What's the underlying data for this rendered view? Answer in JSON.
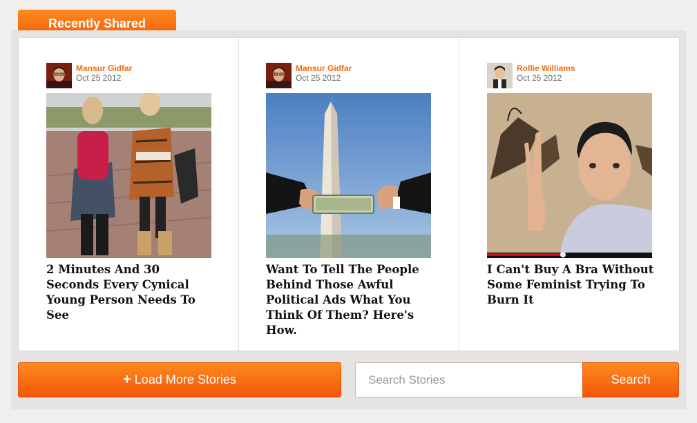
{
  "header": {
    "tab_label": "Recently Shared"
  },
  "stories": [
    {
      "author": "Mansur Gidfar",
      "date": "Oct 25 2012",
      "title": "2 Minutes And 30 Seconds Every Cynical Young Person Needs To See"
    },
    {
      "author": "Mansur Gidfar",
      "date": "Oct 25 2012",
      "title": "Want To Tell The People Behind Those Awful Political Ads What You Think Of Them? Here's How."
    },
    {
      "author": "Rollie Williams",
      "date": "Oct 25 2012",
      "title": "I Can't Buy A Bra Without Some Feminist Trying To Burn It"
    }
  ],
  "actions": {
    "load_more_icon": "+",
    "load_more_label": "Load More Stories",
    "search_placeholder": "Search Stories",
    "search_label": "Search"
  },
  "colors": {
    "accent": "#f26a10",
    "button_top": "#ff8a1e",
    "button_bottom": "#f2560a"
  }
}
